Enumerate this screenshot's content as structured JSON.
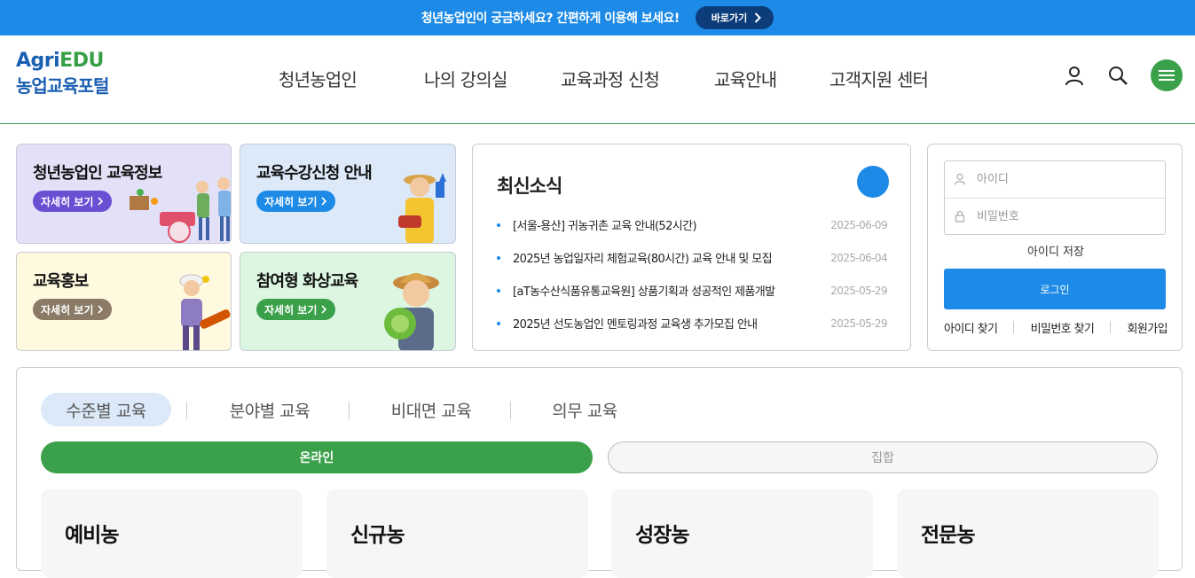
{
  "banner": {
    "text": "청년농업인이 궁금하세요? 간편하게 이용해 보세요!",
    "button": "바로가기"
  },
  "logo": {
    "part1": "Agri",
    "part2": "EDU",
    "subtitle": "농업교육포털"
  },
  "nav": {
    "items": [
      "청년농업인",
      "나의 강의실",
      "교육과정 신청",
      "교육안내",
      "고객지원 센터"
    ]
  },
  "header_icons": [
    "user-icon",
    "search-icon",
    "hamburger-menu-icon"
  ],
  "tiles": [
    {
      "title": "청년농업인 교육정보",
      "button": "자세히 보기",
      "bg": "#e3e1f8",
      "btn_color": "#6a4fd3"
    },
    {
      "title": "교육수강신청 안내",
      "button": "자세히 보기",
      "bg": "#dbe9f8",
      "btn_color": "#1c8ae6"
    },
    {
      "title": "교육홍보",
      "button": "자세히 보기",
      "bg": "#fff9df",
      "btn_color": "#8a7a66"
    },
    {
      "title": "참여형 화상교육",
      "button": "자세히 보기",
      "bg": "#dcf6e2",
      "btn_color": "#3aa14a"
    }
  ],
  "news": {
    "title": "최신소식",
    "items": [
      {
        "text": "[서울-용산] 귀농귀촌 교육 안내(52시간)",
        "date": "2025-06-09"
      },
      {
        "text": "2025년 농업일자리 체험교육(80시간) 교육 안내 및 모집",
        "date": "2025-06-04"
      },
      {
        "text": "[aT농수산식품유통교육원] 상품기획과 성공적인 제품개발",
        "date": "2025-05-29"
      },
      {
        "text": "2025년 선도농업인 멘토링과정 교육생 추가모집 안내",
        "date": "2025-05-29"
      }
    ]
  },
  "login": {
    "id_placeholder": "아이디",
    "pw_placeholder": "비밀번호",
    "save_id": "아이디 저장",
    "button": "로그인",
    "links": [
      "아이디 찾기",
      "비밀번호 찾기",
      "회원가입"
    ]
  },
  "course": {
    "tabs": [
      "수준별 교육",
      "분야별 교육",
      "비대면 교육",
      "의무 교육"
    ],
    "active_tab": 0,
    "modes": [
      "온라인",
      "집합"
    ],
    "active_mode": 0,
    "levels": [
      "예비농",
      "신규농",
      "성장농",
      "전문농"
    ]
  },
  "colors": {
    "primary_blue": "#1c8ae6",
    "primary_green": "#3aa14a",
    "logo_blue": "#1b5fb2"
  }
}
